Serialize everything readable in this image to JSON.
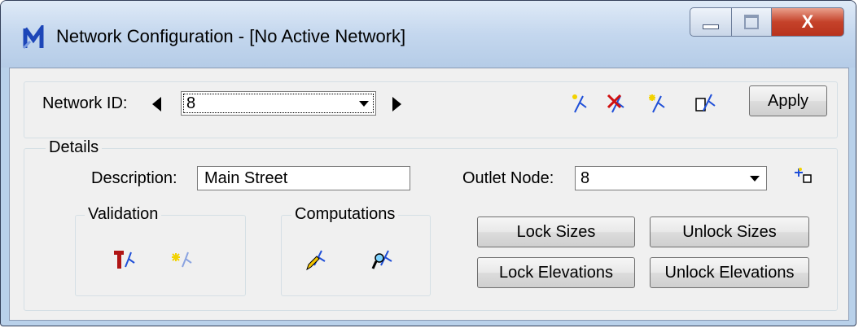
{
  "window": {
    "title": "Network Configuration - [No Active Network]",
    "close_label": "X",
    "app_icon": "app-logo-icon"
  },
  "network": {
    "id_label": "Network ID:",
    "id_value": "8",
    "apply_label": "Apply",
    "icons": [
      "new-network-icon",
      "delete-network-icon",
      "highlight-network-icon",
      "copy-network-icon"
    ]
  },
  "details": {
    "group_label": "Details",
    "description_label": "Description:",
    "description_value": "Main Street",
    "outlet_label": "Outlet Node:",
    "outlet_value": "8",
    "validation_label": "Validation",
    "computations_label": "Computations",
    "lock_sizes_label": "Lock Sizes",
    "unlock_sizes_label": "Unlock Sizes",
    "lock_elevations_label": "Lock Elevations",
    "unlock_elevations_label": "Unlock Elevations"
  },
  "colors": {
    "title_bar": "#c4d7ee",
    "client_bg": "#f0f0f0",
    "close_button": "#c5422a",
    "icon_blue": "#1f4fd8"
  }
}
